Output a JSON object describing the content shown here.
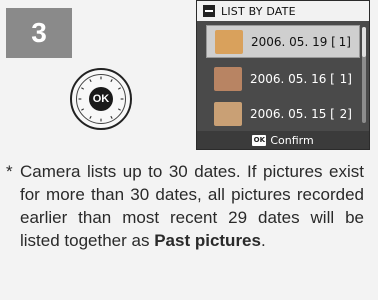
{
  "step": {
    "number": "3"
  },
  "dial": {
    "label": "OK"
  },
  "screen": {
    "title": "LIST BY DATE",
    "rows": [
      {
        "date": "2006. 05. 19 [",
        "count": "1]",
        "selected": true,
        "thumb_color": "#d9a15c"
      },
      {
        "date": "2006. 05. 16 [",
        "count": "1]",
        "selected": false,
        "thumb_color": "#b88463"
      },
      {
        "date": "2006. 05. 15 [",
        "count": "2]",
        "selected": false,
        "thumb_color": "#c9a075"
      }
    ],
    "footer_icon": "OK",
    "footer_label": "Confirm"
  },
  "note": {
    "marker": "*",
    "text": "Camera lists up to 30 dates. If pictures exist for more than 30 dates, all pictures recorded earlier than most recent 29 dates will be listed together as",
    "bold": "Past pictures",
    "end": "."
  }
}
